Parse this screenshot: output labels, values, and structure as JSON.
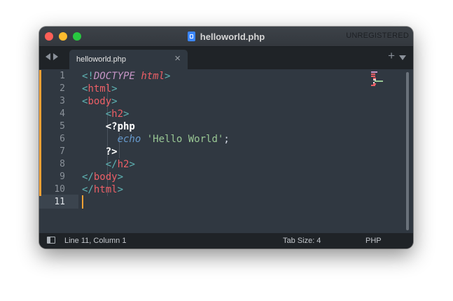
{
  "window": {
    "title": "helloworld.php",
    "license_status": "UNREGISTERED"
  },
  "tabs": [
    {
      "label": "helloworld.php",
      "close": "×",
      "active": true
    }
  ],
  "tabbar": {
    "new_tab": "+"
  },
  "editor": {
    "line_numbers": [
      "1",
      "2",
      "3",
      "4",
      "5",
      "6",
      "7",
      "8",
      "9",
      "10",
      "11"
    ],
    "current_line": 11
  },
  "status": {
    "position": "Line 11, Column 1",
    "tab_size": "Tab Size: 4",
    "syntax": "PHP"
  },
  "colors": {
    "accent": "#f6a135",
    "tag": "#ec5f66",
    "punctuation": "#5fb4b4",
    "string": "#99c794",
    "keyword": "#6699cc",
    "doctype": "#c695c6",
    "background": "#303841"
  },
  "icons": {
    "traffic_lights": [
      "close-icon",
      "minimize-icon",
      "zoom-icon"
    ],
    "file": "php-file-icon",
    "nav": [
      "chevron-left-icon",
      "chevron-right-icon"
    ],
    "tab_menu": "chevron-down-icon",
    "sidebar_toggle": "sidebar-toggle-icon"
  }
}
